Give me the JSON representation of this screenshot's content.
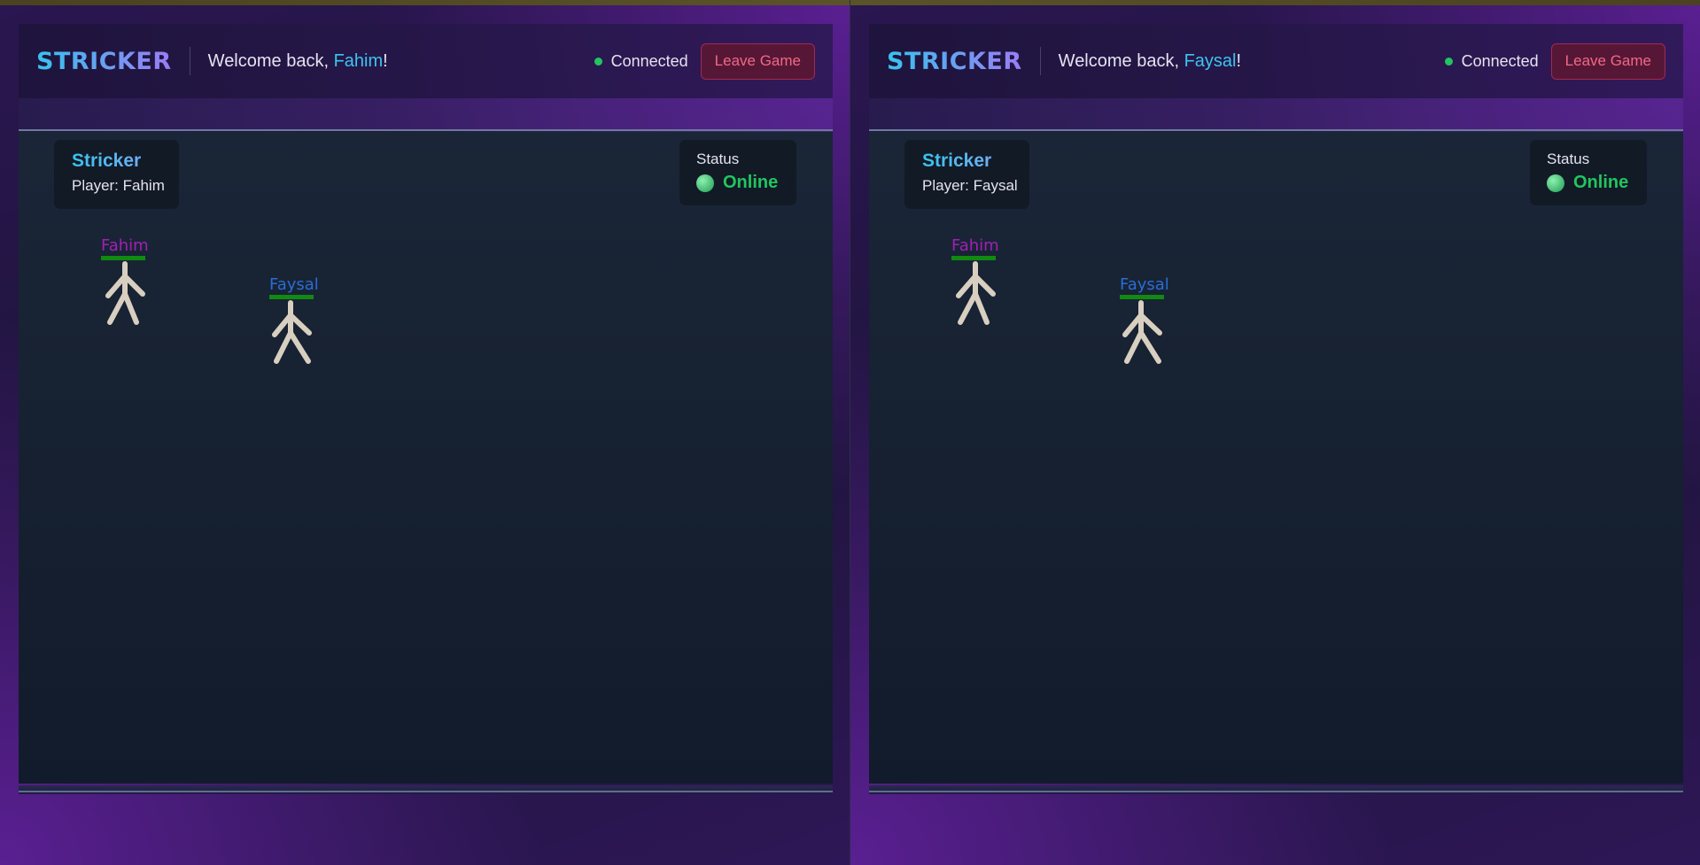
{
  "panes": [
    {
      "brand": "STRICKER",
      "welcome_prefix": "Welcome back, ",
      "username": "Fahim",
      "welcome_suffix": "!",
      "connection": "Connected",
      "leave_label": "Leave Game",
      "info": {
        "title": "Stricker",
        "player": "Player: Fahim"
      },
      "status": {
        "label": "Status",
        "value": "Online"
      },
      "players": [
        {
          "name": "Fahim",
          "color": "#a31fb8"
        },
        {
          "name": "Faysal",
          "color": "#2a6cd6"
        }
      ]
    },
    {
      "brand": "STRICKER",
      "welcome_prefix": "Welcome back, ",
      "username": "Faysal",
      "welcome_suffix": "!",
      "connection": "Connected",
      "leave_label": "Leave Game",
      "info": {
        "title": "Stricker",
        "player": "Player: Faysal"
      },
      "status": {
        "label": "Status",
        "value": "Online"
      },
      "players": [
        {
          "name": "Fahim",
          "color": "#a31fb8"
        },
        {
          "name": "Faysal",
          "color": "#2a6cd6"
        }
      ]
    }
  ],
  "colors": {
    "accent": "#3cc4f0",
    "online": "#22c55e",
    "leave_text": "#f16883",
    "health_bar": "#108a10"
  }
}
